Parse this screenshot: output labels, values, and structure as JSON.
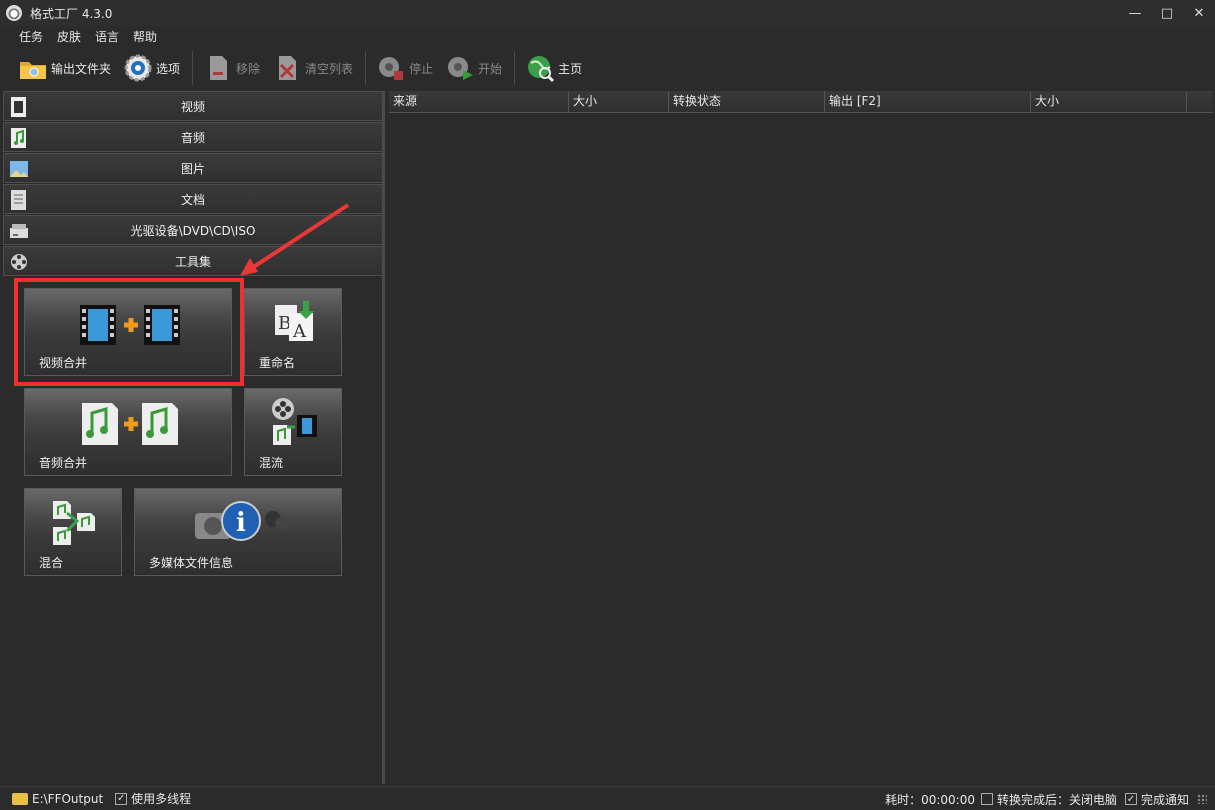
{
  "window": {
    "title": "格式工厂 4.3.0",
    "controls": {
      "minimize": "—",
      "maximize": "□",
      "close": "✕"
    }
  },
  "menu": {
    "items": [
      "任务",
      "皮肤",
      "语言",
      "帮助"
    ]
  },
  "toolbar": {
    "output_folder": "输出文件夹",
    "options": "选项",
    "remove": "移除",
    "clear_list": "清空列表",
    "stop": "停止",
    "start": "开始",
    "home": "主页"
  },
  "categories": [
    {
      "label": "视频",
      "icon": "video-icon"
    },
    {
      "label": "音频",
      "icon": "audio-icon"
    },
    {
      "label": "图片",
      "icon": "image-icon"
    },
    {
      "label": "文档",
      "icon": "document-icon"
    },
    {
      "label": "光驱设备\\DVD\\CD\\ISO",
      "icon": "disc-drive-icon"
    },
    {
      "label": "工具集",
      "icon": "film-reel-icon"
    }
  ],
  "tools": {
    "video_merge": "视频合并",
    "rename": "重命名",
    "audio_merge": "音频合并",
    "mux": "混流",
    "mix": "混合",
    "media_info": "多媒体文件信息"
  },
  "table": {
    "columns": [
      "来源",
      "大小",
      "转换状态",
      "输出 [F2]",
      "大小"
    ]
  },
  "status": {
    "output_path": "E:\\FFOutput",
    "multithread_label": "使用多线程",
    "multithread_checked": true,
    "elapsed": "耗时：00:00:00",
    "after_convert_label": "转换完成后：关闭电脑",
    "after_convert_checked": false,
    "notify_label": "完成通知",
    "notify_checked": true
  },
  "colors": {
    "highlight": "#f03030",
    "annotation_arrow": "#e83838",
    "background": "#2b2b2b"
  }
}
